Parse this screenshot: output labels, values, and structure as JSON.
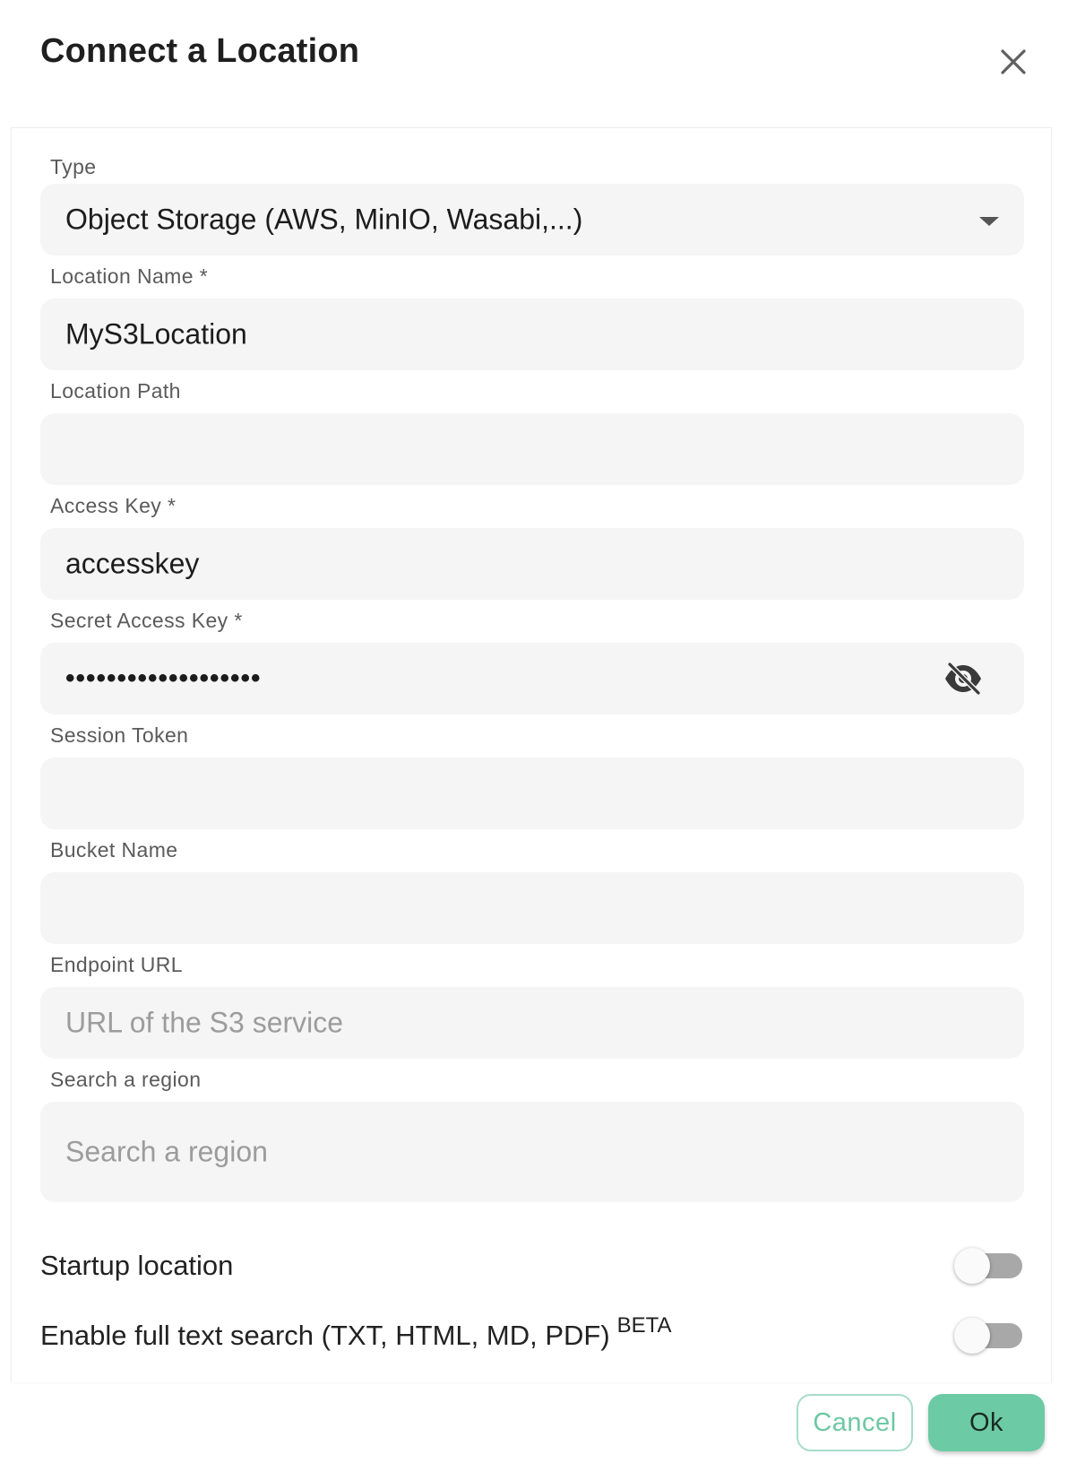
{
  "dialog": {
    "title": "Connect a Location"
  },
  "fields": {
    "type": {
      "label": "Type",
      "value": "Object Storage (AWS, MinIO, Wasabi,...)"
    },
    "location_name": {
      "label": "Location Name *",
      "value": "MyS3Location"
    },
    "location_path": {
      "label": "Location Path",
      "value": ""
    },
    "access_key": {
      "label": "Access Key *",
      "value": "accesskey"
    },
    "secret_access_key": {
      "label": "Secret Access Key *",
      "value": "•••••••••••••••••••"
    },
    "session_token": {
      "label": "Session Token",
      "value": ""
    },
    "bucket_name": {
      "label": "Bucket Name",
      "value": ""
    },
    "endpoint_url": {
      "label": "Endpoint URL",
      "placeholder": "URL of the S3 service"
    },
    "region": {
      "label": "Search a region",
      "placeholder": "Search a region"
    }
  },
  "switches": {
    "startup_location": {
      "label": "Startup location",
      "checked": false
    },
    "full_text_search": {
      "label": "Enable full text search (TXT, HTML, MD, PDF)",
      "badge": "BETA",
      "checked": false
    }
  },
  "actions": {
    "cancel_label": "Cancel",
    "ok_label": "Ok"
  },
  "icons": {
    "close": "close-icon",
    "dropdown": "arrow-drop-down-icon",
    "visibility": "visibility-off-icon"
  },
  "colors": {
    "accent": "#6ccaa4",
    "field_background": "#f5f5f5"
  }
}
